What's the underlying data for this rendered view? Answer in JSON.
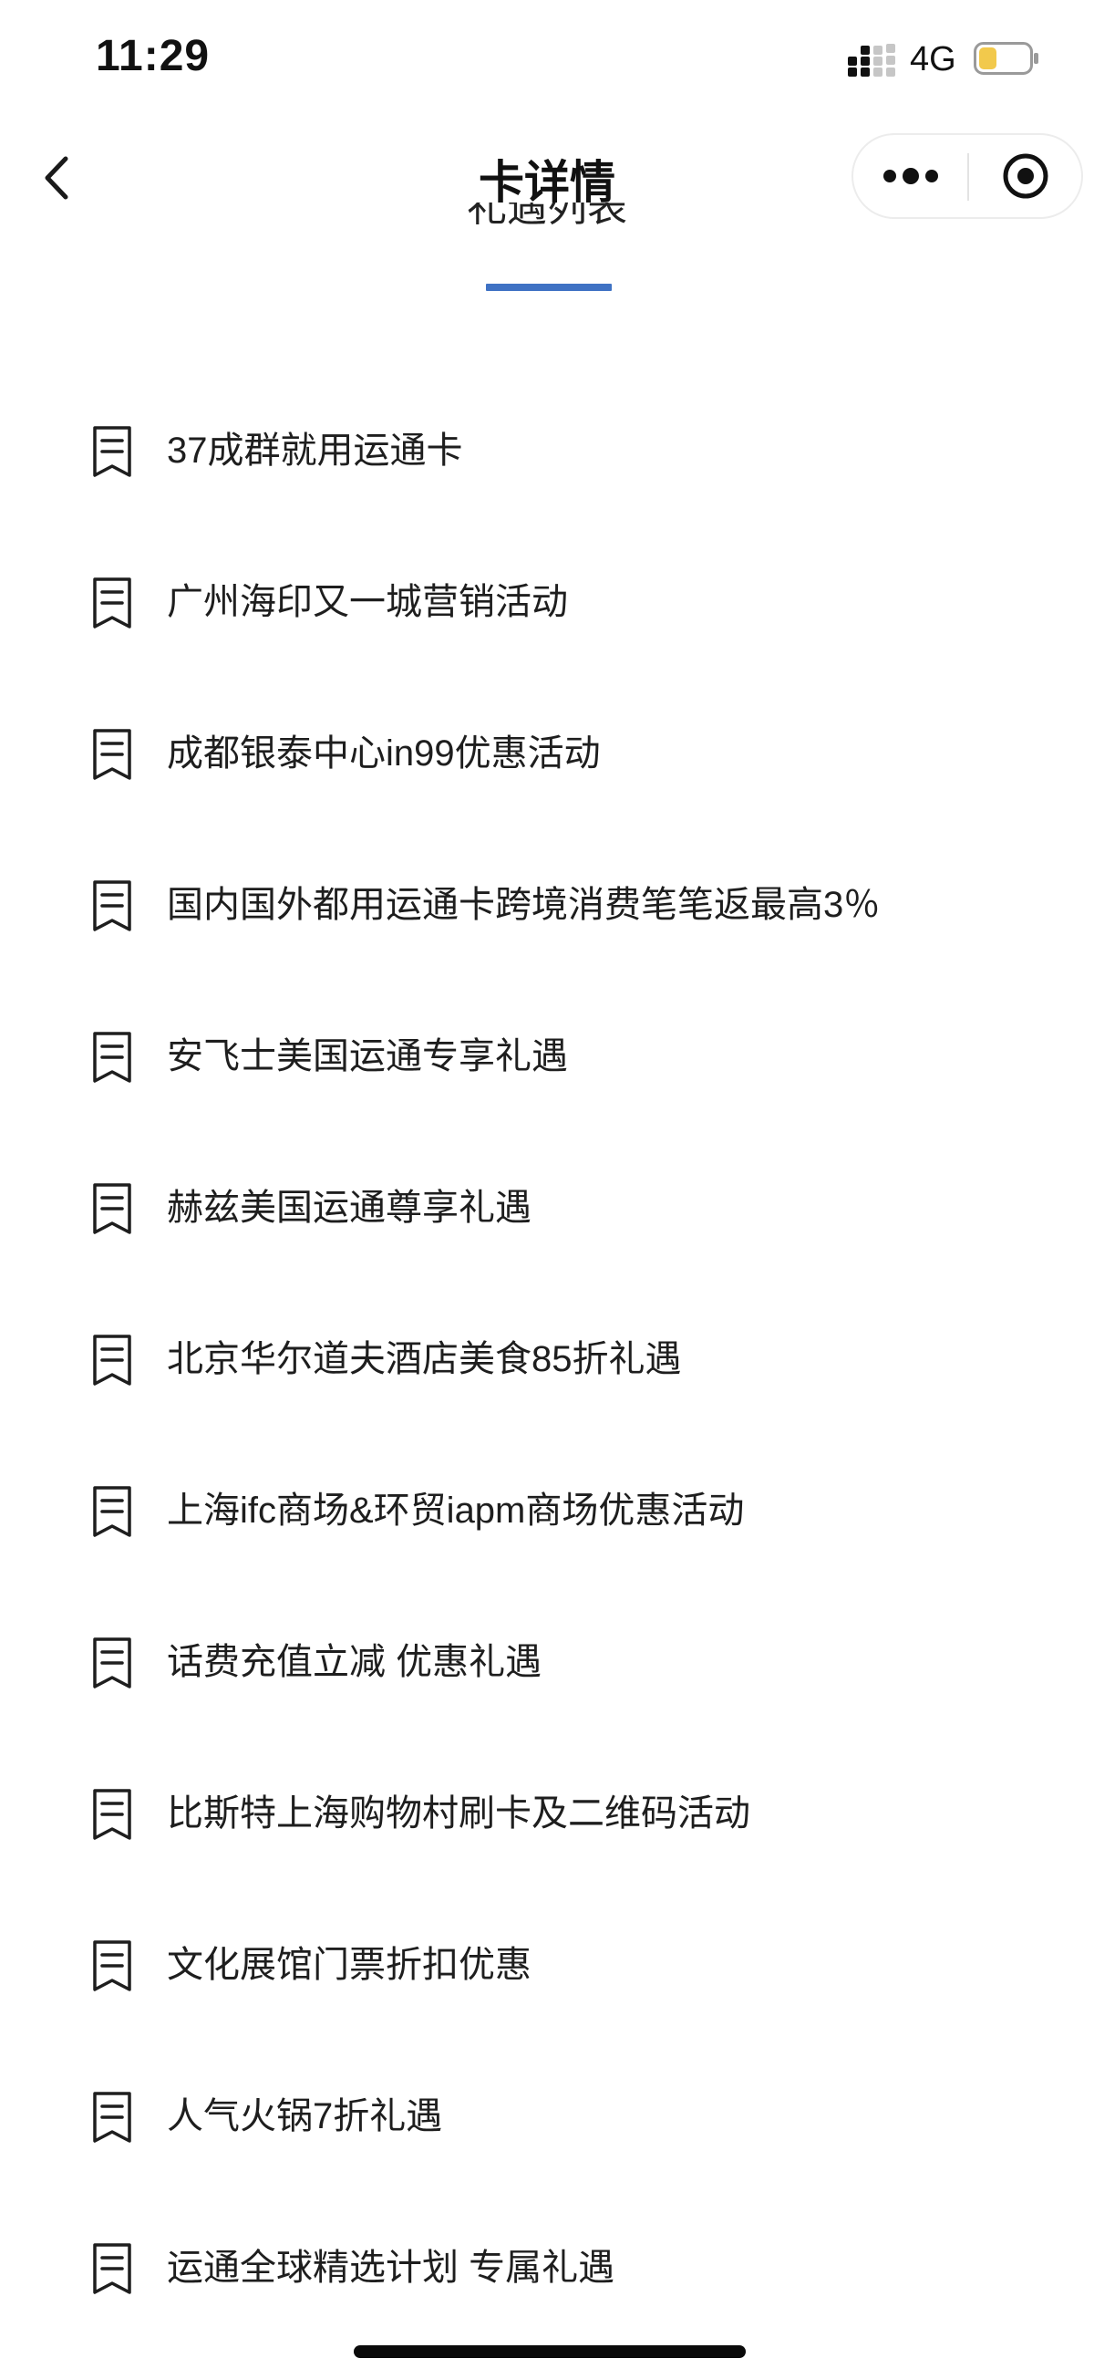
{
  "status_bar": {
    "time": "11:29",
    "network": "4G",
    "signal_icon": "signal-bars-icon",
    "battery_icon": "battery-icon",
    "battery_level": 0.35,
    "battery_color": "#f2c94c"
  },
  "nav": {
    "title": "卡详情",
    "back_icon": "chevron-left-icon",
    "more_icon": "more-dots-icon",
    "close_icon": "target-circle-icon"
  },
  "section": {
    "peek_title": "礼遇列表",
    "accent_color": "#3f72c4"
  },
  "list": {
    "item_icon": "document-icon",
    "items": [
      {
        "label": "37成群就用运通卡"
      },
      {
        "label": "广州海印又一城营销活动"
      },
      {
        "label": "成都银泰中心in99优惠活动"
      },
      {
        "label": "国内国外都用运通卡跨境消费笔笔返最高3％"
      },
      {
        "label": "安飞士美国运通专享礼遇"
      },
      {
        "label": "赫兹美国运通尊享礼遇"
      },
      {
        "label": "北京华尔道夫酒店美食85折礼遇"
      },
      {
        "label": "上海ifc商场&环贸iapm商场优惠活动"
      },
      {
        "label": "话费充值立减 优惠礼遇"
      },
      {
        "label": "比斯特上海购物村刷卡及二维码活动"
      },
      {
        "label": "文化展馆门票折扣优惠"
      },
      {
        "label": "人气火锅7折礼遇"
      },
      {
        "label": "运通全球精选计划 专属礼遇"
      }
    ]
  }
}
